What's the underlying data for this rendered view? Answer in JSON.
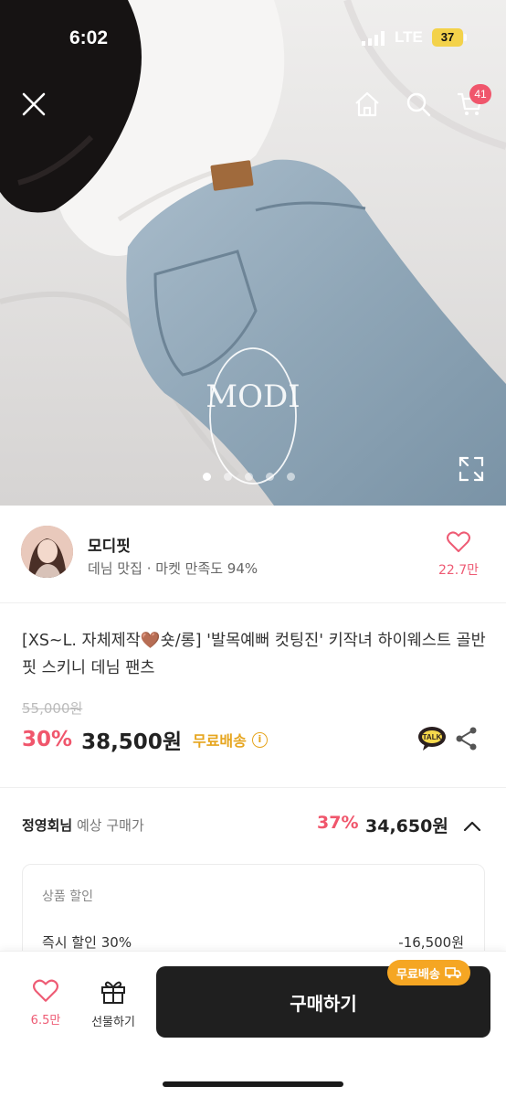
{
  "status_bar": {
    "time": "6:02",
    "network": "LTE",
    "battery": "37"
  },
  "header": {
    "cart_count": "41"
  },
  "hero": {
    "watermark": "MODI",
    "slide_count": 5,
    "active_slide": 1
  },
  "shop": {
    "name": "모디핏",
    "description": "데님 맛집 · 마켓 만족도 94%",
    "likes": "22.7만"
  },
  "product": {
    "title_part1": "[XS~L. 자체제작",
    "title_heart": "🤎",
    "title_part2": "숏/롱] '발목예뻐 컷팅진' 키작녀 하이웨스트 골반핏 스키니 데님 팬츠",
    "original_price": "55,000원",
    "discount_rate": "30%",
    "price": "38,500원",
    "shipping_label": "무료배송",
    "info_icon": "i",
    "talk_label": "TALK"
  },
  "member": {
    "name": "정영회님",
    "label": "예상 구매가",
    "discount_rate": "37%",
    "price": "34,650원"
  },
  "discount_card": {
    "header": "상품 할인",
    "item_label": "즉시 할인 30%",
    "item_value": "-16,500원"
  },
  "bottom_bar": {
    "wish_count": "6.5만",
    "gift_label": "선물하기",
    "buy_label": "구매하기",
    "ship_tag": "무료배송"
  },
  "colors": {
    "accent_pink": "#f0566c",
    "accent_orange": "#f5a623",
    "buy_button": "#1f1f1f"
  }
}
